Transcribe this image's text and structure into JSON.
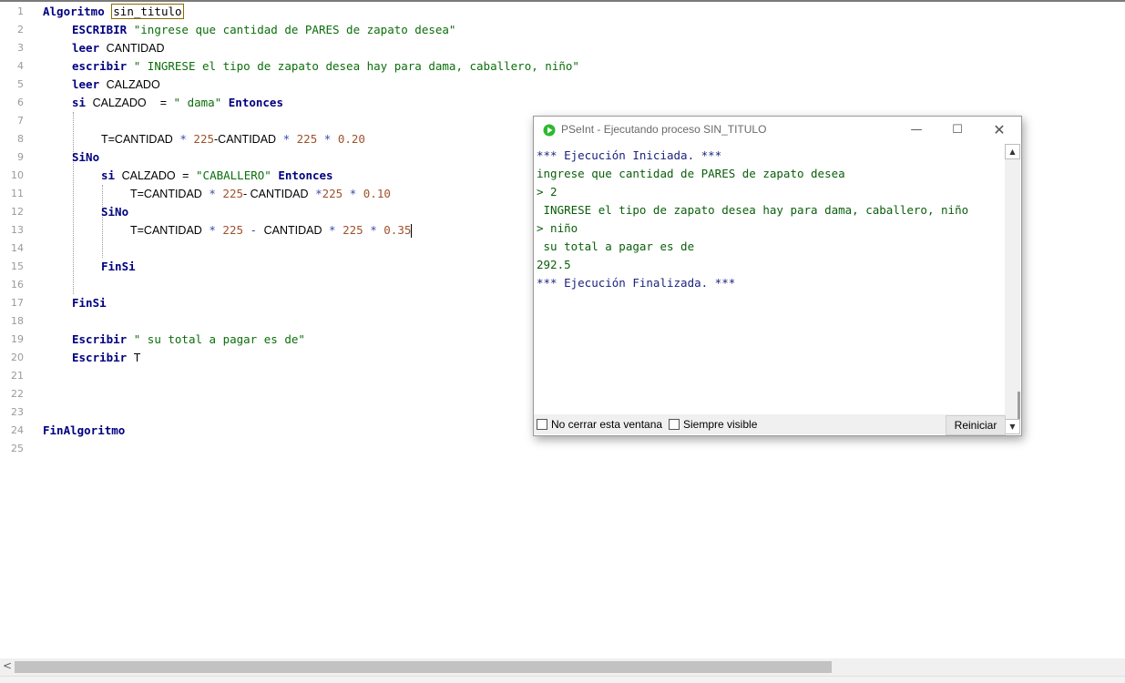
{
  "editor": {
    "line_numbers": [
      "1",
      "2",
      "3",
      "4",
      "5",
      "6",
      "7",
      "8",
      "9",
      "10",
      "11",
      "12",
      "13",
      "14",
      "15",
      "16",
      "17",
      "18",
      "19",
      "20",
      "21",
      "22",
      "23",
      "24",
      "25"
    ],
    "l1": {
      "kw": "Algoritmo",
      "name": "sin_titulo"
    },
    "l2": {
      "kw": "ESCRIBIR",
      "str": "\"ingrese que cantidad de PARES de zapato desea\""
    },
    "l3": {
      "kw": "leer",
      "id": "CANTIDAD"
    },
    "l4": {
      "kw": "escribir",
      "str": "\" INGRESE el tipo de zapato desea hay para dama, caballero, niño\""
    },
    "l5": {
      "kw": "leer",
      "id": "CALZADO"
    },
    "l6": {
      "kw": "si",
      "id": "CALZADO",
      "op": "=",
      "str": "\" dama\"",
      "kw2": "Entonces"
    },
    "l8": {
      "t1": "T=CANTIDAD",
      "op1": "*",
      "n1": "225",
      "t2": "-CANTIDAD",
      "op2": "*",
      "n2": "225",
      "op3": "*",
      "n3": "0.20"
    },
    "l9": {
      "kw": "SiNo"
    },
    "l10": {
      "kw": "si",
      "id": "CALZADO",
      "op": "=",
      "str": "\"CABALLERO\"",
      "kw2": "Entonces"
    },
    "l11": {
      "t1": "T=CANTIDAD",
      "op1": "*",
      "n1": "225",
      "t2": "- CANTIDAD",
      "op2": "*",
      "n2": "225",
      "op3": "*",
      "n3": "0.10"
    },
    "l12": {
      "kw": "SiNo"
    },
    "l13": {
      "t1": "T=CANTIDAD",
      "op1": "*",
      "n1": "225",
      "op2": "-",
      "t2": "CANTIDAD",
      "op3": "*",
      "n2": "225",
      "op4": "*",
      "n3": "0.35"
    },
    "l15": {
      "kw": "FinSi"
    },
    "l17": {
      "kw": "FinSi"
    },
    "l19": {
      "kw": "Escribir",
      "str": "\" su total a pagar es de\""
    },
    "l20": {
      "kw": "Escribir",
      "id": "T"
    },
    "l24": {
      "kw": "FinAlgoritmo"
    }
  },
  "console": {
    "title": "PSeInt - Ejecutando proceso SIN_TITULO",
    "lines": [
      "*** Ejecución Iniciada. ***",
      "ingrese que cantidad de PARES de zapato desea",
      "> 2",
      " INGRESE el tipo de zapato desea hay para dama, caballero, niño",
      "> niño",
      " su total a pagar es de",
      "292.5",
      "*** Ejecución Finalizada. ***"
    ],
    "no_close_label": "No cerrar esta ventana",
    "always_visible_label": "Siempre visible",
    "reset_label": "Reiniciar",
    "window_min": "—",
    "window_max": "☐",
    "window_close": "✕"
  },
  "colors": {
    "keyword": "#000080",
    "string": "#0a6e0a",
    "number": "#a0522d",
    "console_info": "#1a237e",
    "console_text": "#0a5e0a",
    "app_icon": "#2eb82e"
  },
  "icons": {
    "app": "pseint-play-icon",
    "scroll_left": "chevron-left-icon",
    "scroll_up": "arrow-up-icon",
    "scroll_down": "arrow-down-icon"
  }
}
